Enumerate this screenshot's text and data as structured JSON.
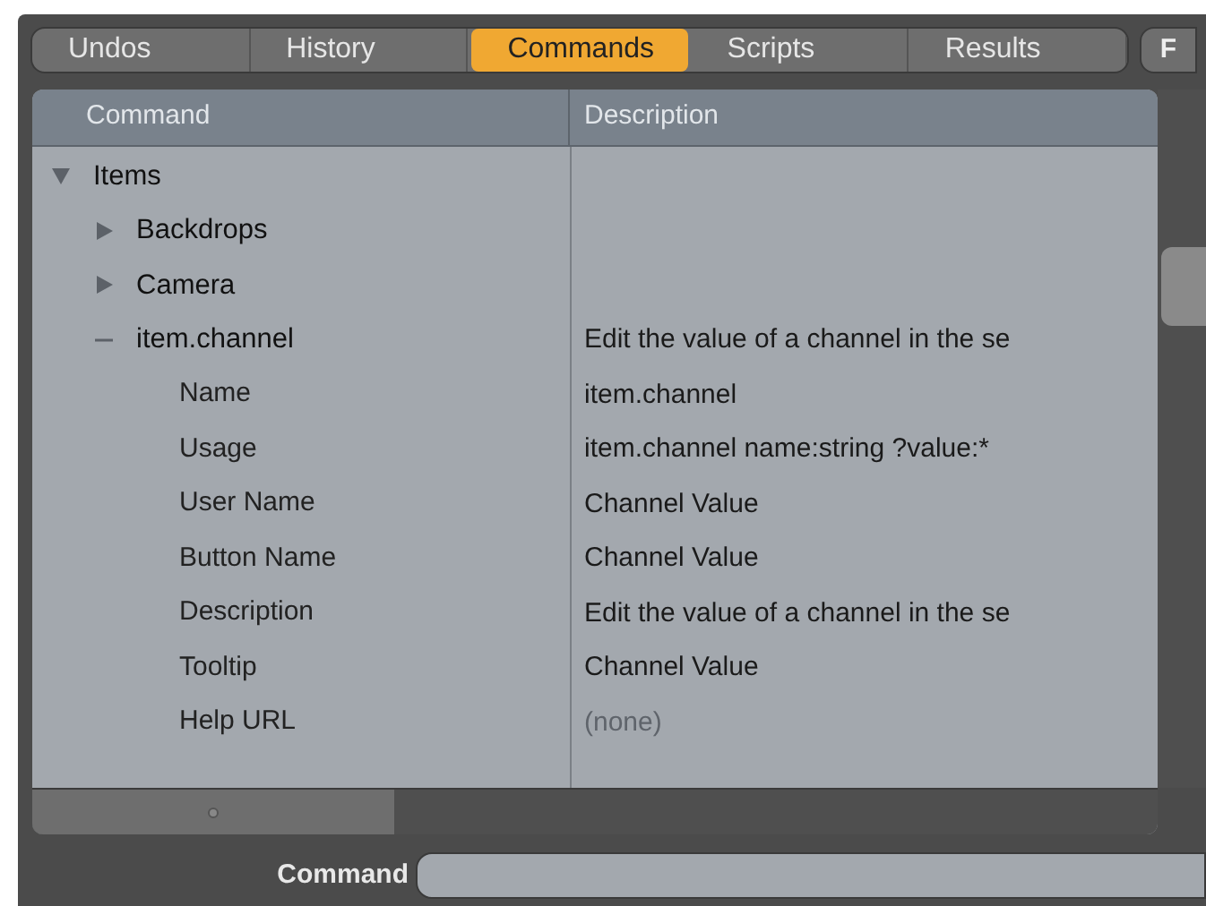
{
  "tabs": [
    {
      "label": "Undos",
      "selected": false
    },
    {
      "label": "History",
      "selected": false
    },
    {
      "label": "Commands",
      "selected": true
    },
    {
      "label": "Scripts",
      "selected": false
    },
    {
      "label": "Results",
      "selected": false
    }
  ],
  "extra_tab": {
    "label": "F"
  },
  "table": {
    "columns": [
      "Command",
      "Description"
    ],
    "tree": [
      {
        "kind": "group",
        "label": "Items",
        "expanded": true,
        "children": [
          {
            "kind": "group",
            "label": "Backdrops",
            "expanded": false
          },
          {
            "kind": "group",
            "label": "Camera",
            "expanded": false
          },
          {
            "kind": "command",
            "label": "item.channel",
            "expanded": true,
            "description": "Edit the value of a channel in the se",
            "children": [
              {
                "kind": "property",
                "label": "Name",
                "description": "item.channel",
                "dimmed": false
              },
              {
                "kind": "property",
                "label": "Usage",
                "description": "item.channel name:string ?value:*",
                "dimmed": false
              },
              {
                "kind": "property",
                "label": "User Name",
                "description": "Channel Value",
                "dimmed": false
              },
              {
                "kind": "property",
                "label": "Button Name",
                "description": "Channel Value",
                "dimmed": false
              },
              {
                "kind": "property",
                "label": "Description",
                "description": "Edit the value of a channel in the se",
                "dimmed": false
              },
              {
                "kind": "property",
                "label": "Tooltip",
                "description": "Channel Value",
                "dimmed": false
              },
              {
                "kind": "property",
                "label": "Help URL",
                "description": "(none)",
                "dimmed": true
              }
            ]
          }
        ]
      }
    ]
  },
  "command_field": {
    "label": "Command"
  }
}
